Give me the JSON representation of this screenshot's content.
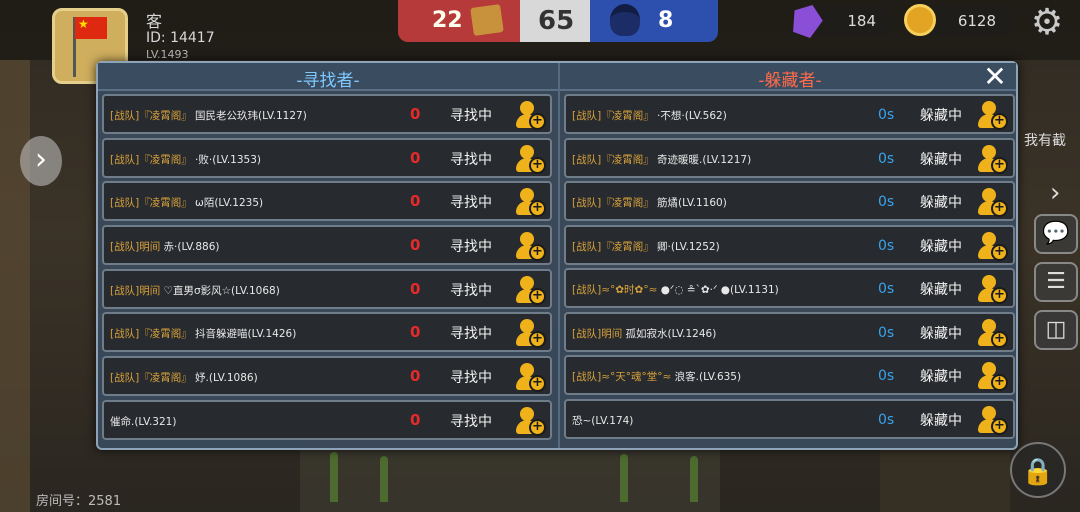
{
  "hud": {
    "player_name": "客",
    "player_id": "ID: 14417",
    "player_level": "LV.1493",
    "red_score": "22",
    "round_time": "65",
    "blue_score": "8",
    "gems": "184",
    "coins": "6128",
    "room_number": "房间号：2581",
    "side_text": "我有截"
  },
  "modal": {
    "seeker_title": "-寻找者-",
    "hider_title": "-躲藏者-",
    "close_label": "✕"
  },
  "seekers": [
    {
      "team": "[战队]『凌霄阁』",
      "name": "国民老公玖玮(LV.1127)",
      "count": "0",
      "status": "寻找中"
    },
    {
      "team": "[战队]『凌霄阁』",
      "name": "·败·(LV.1353)",
      "count": "0",
      "status": "寻找中"
    },
    {
      "team": "[战队]『凌霄阁』",
      "name": "ω陌(LV.1235)",
      "count": "0",
      "status": "寻找中"
    },
    {
      "team": "[战队]明间",
      "name": "赤·(LV.886)",
      "count": "0",
      "status": "寻找中"
    },
    {
      "team": "[战队]明间",
      "name": "♡直男σ影风☆(LV.1068)",
      "count": "0",
      "status": "寻找中"
    },
    {
      "team": "[战队]『凌霄阁』",
      "name": "抖音躲避喵(LV.1426)",
      "count": "0",
      "status": "寻找中"
    },
    {
      "team": "[战队]『凌霄阁』",
      "name": "妤.(LV.1086)",
      "count": "0",
      "status": "寻找中"
    },
    {
      "team": "",
      "name": "催命.(LV.321)",
      "count": "0",
      "status": "寻找中"
    }
  ],
  "hiders": [
    {
      "team": "[战队]『凌霄阁』",
      "name": "·不想·(LV.562)",
      "time": "0s",
      "status": "躲藏中"
    },
    {
      "team": "[战队]『凌霄阁』",
      "name": "奇迹暖暖.(LV.1217)",
      "time": "0s",
      "status": "躲藏中"
    },
    {
      "team": "[战队]『凌霄阁』",
      "name": "筋燏(LV.1160)",
      "time": "0s",
      "status": "躲藏中"
    },
    {
      "team": "[战队]『凌霄阁』",
      "name": "卿·(LV.1252)",
      "time": "0s",
      "status": "躲藏中"
    },
    {
      "team": "[战队]≈°✿时✿°≈",
      "name": "●ᐟ◌ ≗`✿·ᐟ ●(LV.1131)",
      "time": "0s",
      "status": "躲藏中"
    },
    {
      "team": "[战队]明间",
      "name": "孤如寂水(LV.1246)",
      "time": "0s",
      "status": "躲藏中"
    },
    {
      "team": "[战队]≈°天°魂°堂°≈",
      "name": "浪客.(LV.635)",
      "time": "0s",
      "status": "躲藏中"
    },
    {
      "team": "",
      "name": "恐~(LV.174)",
      "time": "0s",
      "status": "躲藏中"
    }
  ]
}
